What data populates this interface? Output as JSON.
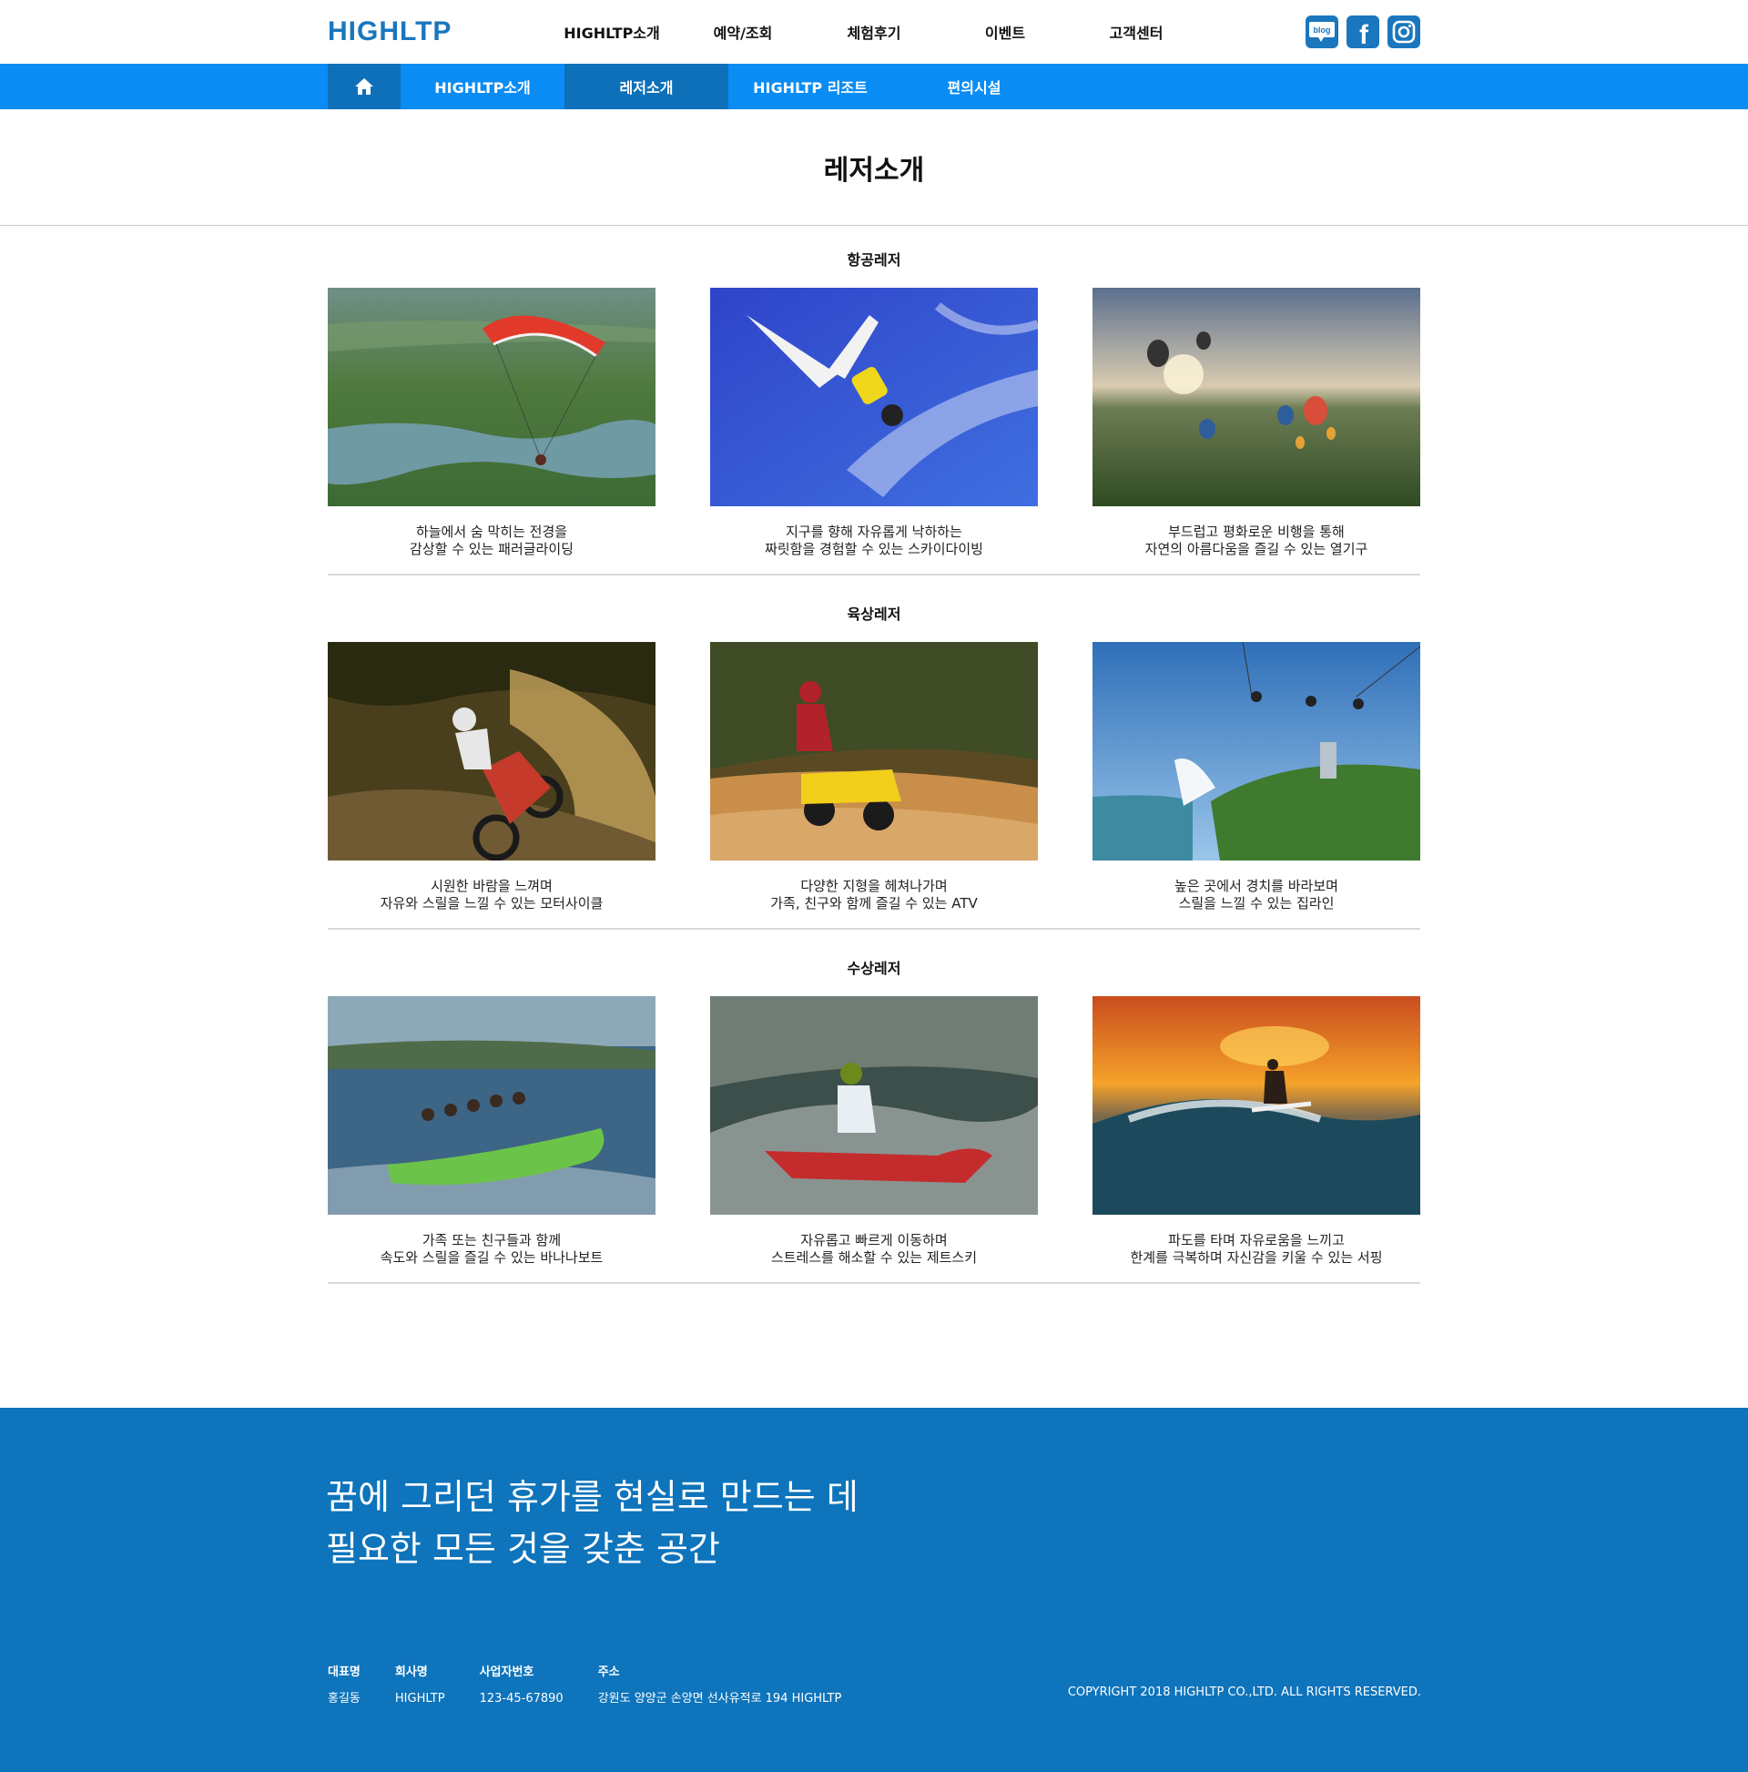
{
  "header": {
    "logo": "HIGHLTP",
    "nav": [
      "HIGHLTP소개",
      "예약/조회",
      "체험후기",
      "이벤트",
      "고객센터"
    ],
    "sns": [
      {
        "name": "blog-icon",
        "label": "blog"
      },
      {
        "name": "facebook-icon",
        "label": "f"
      },
      {
        "name": "instagram-icon",
        "label": ""
      }
    ]
  },
  "subnav": {
    "home_icon": "home-icon",
    "items": [
      "HIGHLTP소개",
      "레저소개",
      "HIGHLTP 리조트",
      "편의시설"
    ],
    "active_index": 1
  },
  "page": {
    "title": "레저소개"
  },
  "sections": [
    {
      "title": "항공레저",
      "cards": [
        {
          "line1": "하늘에서 숨 막히는 전경을",
          "line2": "감상할 수 있는 패러글라이딩"
        },
        {
          "line1": "지구를 향해 자유롭게 낙하하는",
          "line2": "짜릿함을 경험할 수 있는 스카이다이빙"
        },
        {
          "line1": "부드럽고 평화로운 비행을 통해",
          "line2": "자연의 아름다움을 즐길 수 있는 열기구"
        }
      ]
    },
    {
      "title": "육상레저",
      "cards": [
        {
          "line1": "시원한 바람을 느껴며",
          "line2": "자유와 스릴을 느낄 수 있는 모터사이클"
        },
        {
          "line1": "다양한 지형을 헤쳐나가며",
          "line2": "가족, 친구와 함께 즐길 수 있는 ATV"
        },
        {
          "line1": "높은 곳에서 경치를 바라보며",
          "line2": "스릴을 느낄 수 있는 집라인"
        }
      ]
    },
    {
      "title": "수상레저",
      "cards": [
        {
          "line1": "가족 또는 친구들과 함께",
          "line2": "속도와 스릴을 즐길 수 있는 바나나보트"
        },
        {
          "line1": "자유롭고 빠르게 이동하며",
          "line2": "스트레스를 해소할 수 있는 제트스키"
        },
        {
          "line1": "파도를 타며 자유로움을 느끼고",
          "line2": "한계를 극복하며 자신감을 키울 수 있는 서핑"
        }
      ]
    }
  ],
  "footer": {
    "slogan_line1": "꿈에 그리던 휴가를 현실로 만드는 데",
    "slogan_line2": "필요한 모든 것을 갖춘 공간",
    "info": [
      {
        "label": "대표명",
        "value": "홍길동"
      },
      {
        "label": "회사명",
        "value": "HIGHLTP"
      },
      {
        "label": "사업자번호",
        "value": "123-45-67890"
      },
      {
        "label": "주소",
        "value": "강원도 양양군 손양면 선사유적로 194 HIGHLTP"
      }
    ],
    "copyright": "COPYRIGHT 2018 HIGHLTP CO.,LTD. ALL RIGHTS RESERVED."
  }
}
